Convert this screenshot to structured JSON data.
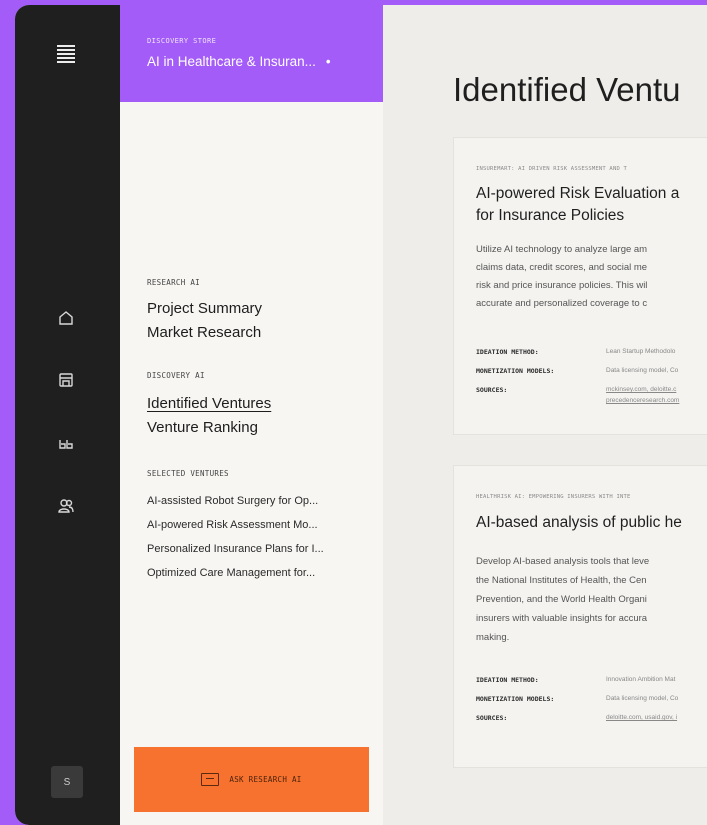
{
  "store": {
    "kicker": "DISCOVERY STORE",
    "name": "AI in Healthcare & Insuran...",
    "dot": "•"
  },
  "nav": {
    "research_label": "RESEARCH AI",
    "project_summary": "Project Summary",
    "market_research": "Market Research",
    "discovery_label": "DISCOVERY AI",
    "identified_ventures": "Identified Ventures",
    "venture_ranking": "Venture Ranking",
    "selected_label": "SELECTED VENTURES",
    "selected": [
      "AI-assisted Robot Surgery for Op...",
      "AI-powered Risk Assessment Mo...",
      "Personalized Insurance Plans for I...",
      "Optimized Care Management for..."
    ]
  },
  "ask_button": {
    "label": "ASK RESEARCH AI"
  },
  "user": {
    "initial": "S"
  },
  "main": {
    "title": "Identified Ventu",
    "cards": [
      {
        "tag": "INSUREMART: AI DRIVEN RISK ASSESSMENT AND T",
        "title_lines": [
          "AI-powered Risk Evaluation a",
          "for Insurance Policies"
        ],
        "desc_lines": [
          "Utilize AI technology to analyze large am",
          "claims data, credit scores, and social me",
          "risk and price insurance policies. This wil",
          "accurate and personalized coverage to c"
        ],
        "meta": [
          {
            "key": "IDEATION METHOD:",
            "value": "Lean Startup Methodolo"
          },
          {
            "key": "MONETIZATION MODELS:",
            "value": "Data licensing model, Co"
          },
          {
            "key": "SOURCES:",
            "value": "mckinsey.com, deloitte.c",
            "value2": "precedenceresearch.com"
          }
        ]
      },
      {
        "tag": "HEALTHRISK AI: EMPOWERING INSURERS WITH INTE",
        "title_lines": [
          "AI-based analysis of public he"
        ],
        "desc_lines": [
          "Develop AI-based analysis tools that leve",
          "the National Institutes of Health, the Cen",
          "Prevention, and the World Health Organi",
          "insurers with valuable insights for accura",
          "making."
        ],
        "meta": [
          {
            "key": "IDEATION METHOD:",
            "value": "Innovation Ambition Mat"
          },
          {
            "key": "MONETIZATION MODELS:",
            "value": "Data licensing model, Co"
          },
          {
            "key": "SOURCES:",
            "value": "deloitte.com, usaid.gov, i"
          }
        ]
      }
    ]
  },
  "icons": [
    "menu-logo-icon",
    "home-icon",
    "store-icon",
    "quote-icon",
    "users-icon",
    "chat-icon"
  ],
  "colors": {
    "accent_purple": "#a35cf7",
    "accent_orange": "#f7712f",
    "rail": "#1f1f1f"
  }
}
